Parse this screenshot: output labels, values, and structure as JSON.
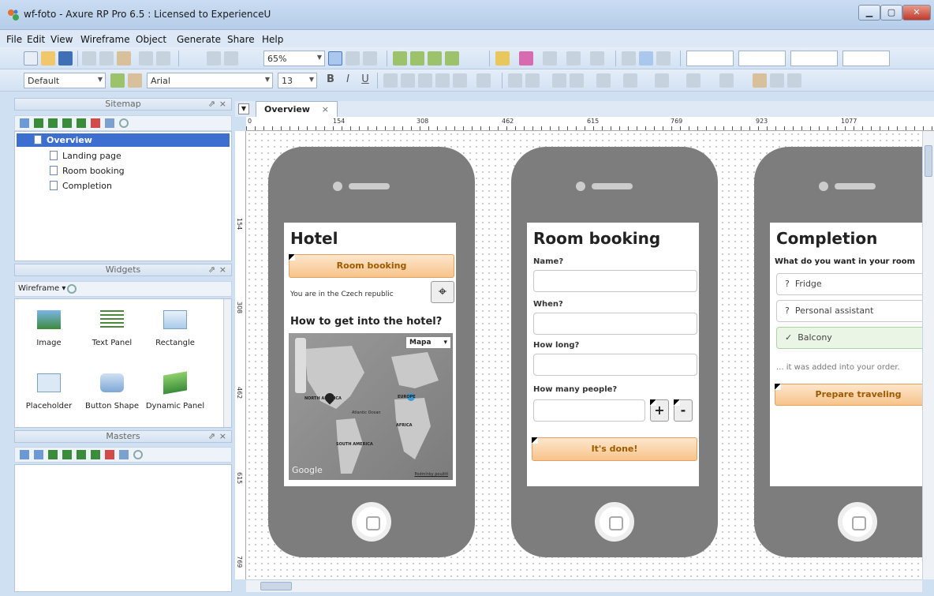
{
  "window": {
    "title": "wf-foto - Axure RP Pro 6.5 : Licensed to ExperienceU"
  },
  "menu": [
    "File",
    "Edit",
    "View",
    "Wireframe",
    "Object",
    "Generate",
    "Share",
    "Help"
  ],
  "toolbar": {
    "zoom": "65%",
    "style": "Default",
    "font": "Arial",
    "font_size": "13",
    "bold": "B",
    "italic": "I",
    "underline": "U"
  },
  "sitemap": {
    "title": "Sitemap",
    "root": "Overview",
    "pages": [
      "Landing page",
      "Room booking",
      "Completion"
    ]
  },
  "widgets": {
    "title": "Widgets",
    "library": "Wireframe",
    "items": [
      "Image",
      "Text Panel",
      "Rectangle",
      "Placeholder",
      "Button Shape",
      "Dynamic Panel"
    ]
  },
  "masters": {
    "title": "Masters"
  },
  "panel_controls": {
    "pin": "⇗",
    "close": "×"
  },
  "tab": {
    "label": "Overview",
    "close": "×"
  },
  "ruler": {
    "h": [
      "0",
      "154",
      "308",
      "462",
      "615",
      "769",
      "923",
      "1077"
    ],
    "v": [
      "154",
      "308",
      "462",
      "615",
      "769"
    ]
  },
  "hotel": {
    "title": "Hotel",
    "button": "Room booking",
    "location": "You are in the Czech republic",
    "heading": "How to get into the hotel?",
    "map_type": "Mapa",
    "map_labels": [
      "NORTH AMERICA",
      "EUROPE",
      "AFRICA",
      "SOUTH AMERICA",
      "Atlantic Ocean"
    ],
    "google": "Google",
    "terms": "Podmínky použití"
  },
  "booking": {
    "title": "Room booking",
    "name": "Name?",
    "when": "When?",
    "howlong": "How long?",
    "people": "How many people?",
    "plus": "+",
    "minus": "-",
    "done": "It's done!"
  },
  "completion": {
    "title": "Completion",
    "question": "What do you want in your room",
    "options": [
      "Fridge",
      "Personal assistant",
      "Balcony"
    ],
    "option_marks": [
      "?",
      "?",
      "✓"
    ],
    "note": "... it was added into your order.",
    "button": "Prepare traveling"
  }
}
